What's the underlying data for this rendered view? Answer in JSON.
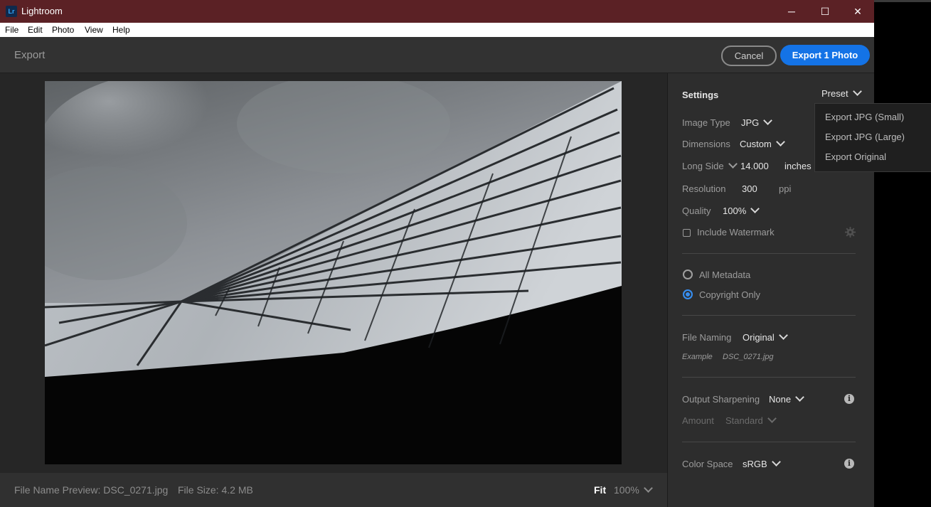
{
  "window": {
    "title": "Lightroom",
    "logo_text": "Lr",
    "minimize": "─",
    "maximize": "☐",
    "close": "✕"
  },
  "menu": {
    "file": "File",
    "edit": "Edit",
    "photo": "Photo",
    "view": "View",
    "help": "Help"
  },
  "header": {
    "title": "Export",
    "cancel": "Cancel",
    "export": "Export 1 Photo"
  },
  "status": {
    "file_name": "File Name Preview: DSC_0271.jpg",
    "file_size": "File Size: 4.2 MB",
    "fit": "Fit",
    "zoom": "100%"
  },
  "settings": {
    "title": "Settings",
    "preset": "Preset",
    "image_type_label": "Image Type",
    "image_type": "JPG",
    "dimensions_label": "Dimensions",
    "dimensions": "Custom",
    "long_side_label": "Long Side",
    "long_side": "14.000",
    "long_side_unit": "inches",
    "resolution_label": "Resolution",
    "resolution": "300",
    "resolution_unit": "ppi",
    "quality_label": "Quality",
    "quality": "100%",
    "watermark_label": "Include Watermark",
    "metadata_all": "All Metadata",
    "metadata_copyright": "Copyright Only",
    "file_naming_label": "File Naming",
    "file_naming": "Original",
    "example_label": "Example",
    "example_value": "DSC_0271.jpg",
    "sharpening_label": "Output Sharpening",
    "sharpening": "None",
    "amount_label": "Amount",
    "amount": "Standard",
    "color_space_label": "Color Space",
    "color_space": "sRGB"
  },
  "preset_menu": [
    "Export JPG (Small)",
    "Export JPG (Large)",
    "Export Original"
  ],
  "colors": {
    "title_bar": "#5b2125",
    "accent": "#1473e6",
    "panel": "#2d2d2d"
  }
}
